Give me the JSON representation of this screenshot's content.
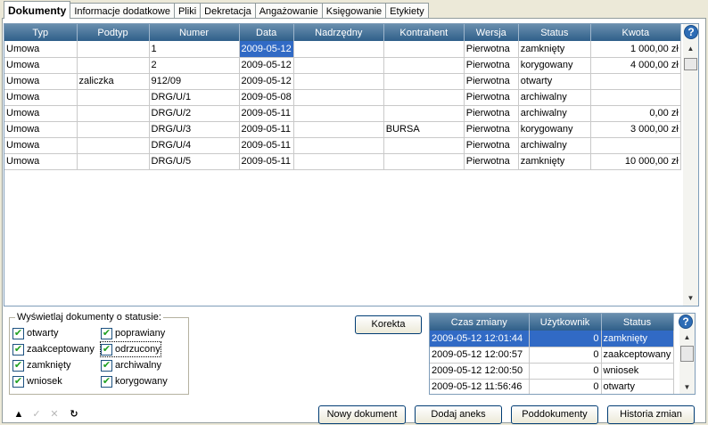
{
  "tabs": [
    "Dokumenty",
    "Informacje dodatkowe",
    "Pliki",
    "Dekretacja",
    "Angażowanie",
    "Księgowanie",
    "Etykiety"
  ],
  "grid": {
    "columns": [
      "Typ",
      "Podtyp",
      "Numer",
      "Data",
      "Nadrzędny",
      "Kontrahent",
      "Wersja",
      "Status",
      "Kwota"
    ],
    "rows": [
      [
        "Umowa",
        "",
        "1",
        "2009-05-12",
        "",
        "",
        "Pierwotna",
        "zamknięty",
        "1 000,00 zł"
      ],
      [
        "Umowa",
        "",
        "2",
        "2009-05-12",
        "",
        "",
        "Pierwotna",
        "korygowany",
        "4 000,00 zł"
      ],
      [
        "Umowa",
        "zaliczka",
        "912/09",
        "2009-05-12",
        "",
        "",
        "Pierwotna",
        "otwarty",
        ""
      ],
      [
        "Umowa",
        "",
        "DRG/U/1",
        "2009-05-08",
        "",
        "",
        "Pierwotna",
        "archiwalny",
        ""
      ],
      [
        "Umowa",
        "",
        "DRG/U/2",
        "2009-05-11",
        "",
        "",
        "Pierwotna",
        "archiwalny",
        "0,00 zł"
      ],
      [
        "Umowa",
        "",
        "DRG/U/3",
        "2009-05-11",
        "",
        "BURSA",
        "Pierwotna",
        "korygowany",
        "3 000,00 zł"
      ],
      [
        "Umowa",
        "",
        "DRG/U/4",
        "2009-05-11",
        "",
        "",
        "Pierwotna",
        "archiwalny",
        ""
      ],
      [
        "Umowa",
        "",
        "DRG/U/5",
        "2009-05-11",
        "",
        "",
        "Pierwotna",
        "zamknięty",
        "10 000,00 zł"
      ]
    ]
  },
  "filter": {
    "legend": "Wyświetlaj dokumenty o statusie:",
    "items": [
      {
        "label": "otwarty",
        "checked": true
      },
      {
        "label": "poprawiany",
        "checked": true
      },
      {
        "label": "zaakceptowany",
        "checked": true
      },
      {
        "label": "odrzucony",
        "checked": true
      },
      {
        "label": "zamknięty",
        "checked": true
      },
      {
        "label": "archiwalny",
        "checked": true
      },
      {
        "label": "wniosek",
        "checked": true
      },
      {
        "label": "korygowany",
        "checked": true
      }
    ]
  },
  "buttons": {
    "korekta": "Korekta",
    "nowy_dokument": "Nowy dokument",
    "dodaj_aneks": "Dodaj aneks",
    "poddokumenty": "Poddokumenty",
    "historia_zmian": "Historia zmian"
  },
  "history": {
    "columns": [
      "Czas zmiany",
      "Użytkownik",
      "Status"
    ],
    "rows": [
      [
        "2009-05-12 12:01:44",
        "0",
        "zamknięty"
      ],
      [
        "2009-05-12 12:00:57",
        "0",
        "zaakceptowany"
      ],
      [
        "2009-05-12 12:00:50",
        "0",
        "wniosek"
      ],
      [
        "2009-05-12 11:56:46",
        "0",
        "otwarty"
      ]
    ]
  },
  "help_icon": "?",
  "colors": {
    "header": "#3f6f98",
    "selection": "#316ac5",
    "check": "#21a121"
  }
}
